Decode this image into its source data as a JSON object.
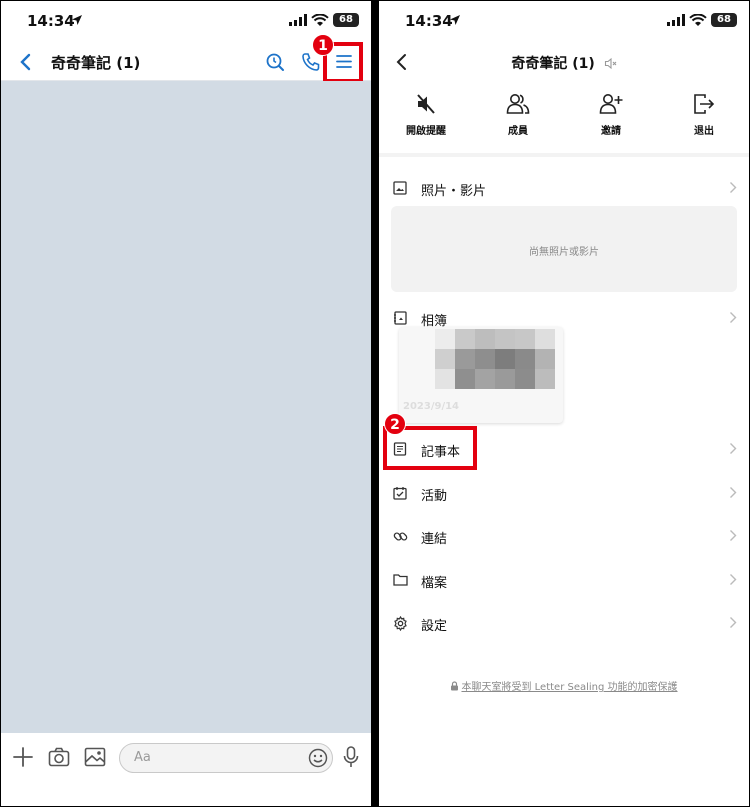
{
  "status_bar": {
    "time": "14:34",
    "battery": "68"
  },
  "chat": {
    "title": "奇奇筆記 (1)",
    "input_placeholder": "Aa",
    "background_color": "#d2dbe4",
    "accent_color": "#1d73c9"
  },
  "annotations": {
    "step1": "1",
    "step2": "2",
    "highlight_color": "#e3000f"
  },
  "settings": {
    "title": "奇奇筆記 (1)",
    "actions": [
      {
        "label": "開啟提醒",
        "icon": "mute-icon"
      },
      {
        "label": "成員",
        "icon": "members-icon"
      },
      {
        "label": "邀請",
        "icon": "invite-icon"
      },
      {
        "label": "退出",
        "icon": "exit-icon"
      }
    ],
    "photos": {
      "label": "照片・影片",
      "empty_text": "尚無照片或影片"
    },
    "album": {
      "label": "相簿",
      "date": "2023/9/14"
    },
    "menu": [
      {
        "label": "記事本",
        "icon": "note-icon"
      },
      {
        "label": "活動",
        "icon": "calendar-icon"
      },
      {
        "label": "連結",
        "icon": "link-icon"
      },
      {
        "label": "檔案",
        "icon": "folder-icon"
      },
      {
        "label": "設定",
        "icon": "gear-icon"
      }
    ],
    "footer_note": "本聊天室將受到 Letter Sealing 功能的加密保護"
  }
}
